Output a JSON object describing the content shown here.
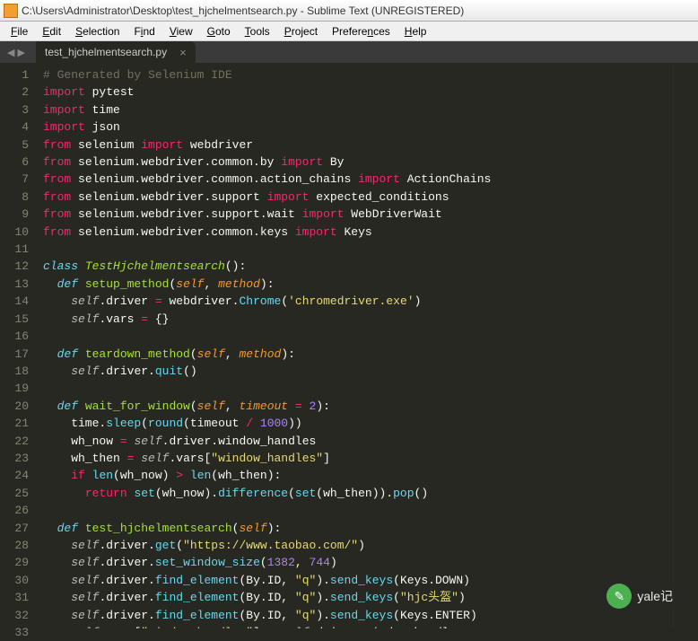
{
  "window": {
    "title": "C:\\Users\\Administrator\\Desktop\\test_hjchelmentsearch.py - Sublime Text (UNREGISTERED)"
  },
  "menu": {
    "items": [
      {
        "label": "File",
        "accel": "F"
      },
      {
        "label": "Edit",
        "accel": "E"
      },
      {
        "label": "Selection",
        "accel": "S"
      },
      {
        "label": "Find",
        "accel": "i"
      },
      {
        "label": "View",
        "accel": "V"
      },
      {
        "label": "Goto",
        "accel": "G"
      },
      {
        "label": "Tools",
        "accel": "T"
      },
      {
        "label": "Project",
        "accel": "P"
      },
      {
        "label": "Preferences",
        "accel": "n"
      },
      {
        "label": "Help",
        "accel": "H"
      }
    ]
  },
  "tab": {
    "name": "test_hjchelmentsearch.py",
    "close": "×"
  },
  "nav": {
    "arrows": "◀ ▶"
  },
  "code": {
    "lines": [
      [
        {
          "t": "# Generated by Selenium IDE",
          "c": "c-comment"
        }
      ],
      [
        {
          "t": "import",
          "c": "c-kw"
        },
        {
          "t": " pytest"
        }
      ],
      [
        {
          "t": "import",
          "c": "c-kw"
        },
        {
          "t": " time"
        }
      ],
      [
        {
          "t": "import",
          "c": "c-kw"
        },
        {
          "t": " json"
        }
      ],
      [
        {
          "t": "from",
          "c": "c-kw"
        },
        {
          "t": " selenium "
        },
        {
          "t": "import",
          "c": "c-kw"
        },
        {
          "t": " webdriver"
        }
      ],
      [
        {
          "t": "from",
          "c": "c-kw"
        },
        {
          "t": " selenium.webdriver.common.by "
        },
        {
          "t": "import",
          "c": "c-kw"
        },
        {
          "t": " By"
        }
      ],
      [
        {
          "t": "from",
          "c": "c-kw"
        },
        {
          "t": " selenium.webdriver.common.action_chains "
        },
        {
          "t": "import",
          "c": "c-kw"
        },
        {
          "t": " ActionChains"
        }
      ],
      [
        {
          "t": "from",
          "c": "c-kw"
        },
        {
          "t": " selenium.webdriver.support "
        },
        {
          "t": "import",
          "c": "c-kw"
        },
        {
          "t": " expected_conditions"
        }
      ],
      [
        {
          "t": "from",
          "c": "c-kw"
        },
        {
          "t": " selenium.webdriver.support.wait "
        },
        {
          "t": "import",
          "c": "c-kw"
        },
        {
          "t": " WebDriverWait"
        }
      ],
      [
        {
          "t": "from",
          "c": "c-kw"
        },
        {
          "t": " selenium.webdriver.common.keys "
        },
        {
          "t": "import",
          "c": "c-kw"
        },
        {
          "t": " Keys"
        }
      ],
      [],
      [
        {
          "t": "class",
          "c": "c-def"
        },
        {
          "t": " "
        },
        {
          "t": "TestHjchelmentsearch",
          "c": "c-cls"
        },
        {
          "t": "():"
        }
      ],
      [
        {
          "t": "  "
        },
        {
          "t": "def",
          "c": "c-def"
        },
        {
          "t": " "
        },
        {
          "t": "setup_method",
          "c": "c-fn"
        },
        {
          "t": "("
        },
        {
          "t": "self",
          "c": "c-param"
        },
        {
          "t": ", "
        },
        {
          "t": "method",
          "c": "c-param"
        },
        {
          "t": "):"
        }
      ],
      [
        {
          "t": "    "
        },
        {
          "t": "self",
          "c": "c-self"
        },
        {
          "t": ".driver "
        },
        {
          "t": "=",
          "c": "c-op"
        },
        {
          "t": " webdriver."
        },
        {
          "t": "Chrome",
          "c": "c-call"
        },
        {
          "t": "("
        },
        {
          "t": "'chromedriver.exe'",
          "c": "c-str"
        },
        {
          "t": ")"
        }
      ],
      [
        {
          "t": "    "
        },
        {
          "t": "self",
          "c": "c-self"
        },
        {
          "t": ".vars "
        },
        {
          "t": "=",
          "c": "c-op"
        },
        {
          "t": " {}"
        }
      ],
      [],
      [
        {
          "t": "  "
        },
        {
          "t": "def",
          "c": "c-def"
        },
        {
          "t": " "
        },
        {
          "t": "teardown_method",
          "c": "c-fn"
        },
        {
          "t": "("
        },
        {
          "t": "self",
          "c": "c-param"
        },
        {
          "t": ", "
        },
        {
          "t": "method",
          "c": "c-param"
        },
        {
          "t": "):"
        }
      ],
      [
        {
          "t": "    "
        },
        {
          "t": "self",
          "c": "c-self"
        },
        {
          "t": ".driver."
        },
        {
          "t": "quit",
          "c": "c-call"
        },
        {
          "t": "()"
        }
      ],
      [],
      [
        {
          "t": "  "
        },
        {
          "t": "def",
          "c": "c-def"
        },
        {
          "t": " "
        },
        {
          "t": "wait_for_window",
          "c": "c-fn"
        },
        {
          "t": "("
        },
        {
          "t": "self",
          "c": "c-param"
        },
        {
          "t": ", "
        },
        {
          "t": "timeout",
          "c": "c-param"
        },
        {
          "t": " "
        },
        {
          "t": "=",
          "c": "c-op"
        },
        {
          "t": " "
        },
        {
          "t": "2",
          "c": "c-num"
        },
        {
          "t": "):"
        }
      ],
      [
        {
          "t": "    time."
        },
        {
          "t": "sleep",
          "c": "c-call"
        },
        {
          "t": "("
        },
        {
          "t": "round",
          "c": "c-call"
        },
        {
          "t": "(timeout "
        },
        {
          "t": "/",
          "c": "c-op"
        },
        {
          "t": " "
        },
        {
          "t": "1000",
          "c": "c-num"
        },
        {
          "t": "))"
        }
      ],
      [
        {
          "t": "    wh_now "
        },
        {
          "t": "=",
          "c": "c-op"
        },
        {
          "t": " "
        },
        {
          "t": "self",
          "c": "c-self"
        },
        {
          "t": ".driver.window_handles"
        }
      ],
      [
        {
          "t": "    wh_then "
        },
        {
          "t": "=",
          "c": "c-op"
        },
        {
          "t": " "
        },
        {
          "t": "self",
          "c": "c-self"
        },
        {
          "t": ".vars["
        },
        {
          "t": "\"window_handles\"",
          "c": "c-str"
        },
        {
          "t": "]"
        }
      ],
      [
        {
          "t": "    "
        },
        {
          "t": "if",
          "c": "c-kw"
        },
        {
          "t": " "
        },
        {
          "t": "len",
          "c": "c-call"
        },
        {
          "t": "(wh_now) "
        },
        {
          "t": ">",
          "c": "c-op"
        },
        {
          "t": " "
        },
        {
          "t": "len",
          "c": "c-call"
        },
        {
          "t": "(wh_then):"
        }
      ],
      [
        {
          "t": "      "
        },
        {
          "t": "return",
          "c": "c-kw"
        },
        {
          "t": " "
        },
        {
          "t": "set",
          "c": "c-call"
        },
        {
          "t": "(wh_now)."
        },
        {
          "t": "difference",
          "c": "c-call"
        },
        {
          "t": "("
        },
        {
          "t": "set",
          "c": "c-call"
        },
        {
          "t": "(wh_then))."
        },
        {
          "t": "pop",
          "c": "c-call"
        },
        {
          "t": "()"
        }
      ],
      [],
      [
        {
          "t": "  "
        },
        {
          "t": "def",
          "c": "c-def"
        },
        {
          "t": " "
        },
        {
          "t": "test_hjchelmentsearch",
          "c": "c-fn"
        },
        {
          "t": "("
        },
        {
          "t": "self",
          "c": "c-param"
        },
        {
          "t": "):"
        }
      ],
      [
        {
          "t": "    "
        },
        {
          "t": "self",
          "c": "c-self"
        },
        {
          "t": ".driver."
        },
        {
          "t": "get",
          "c": "c-call"
        },
        {
          "t": "("
        },
        {
          "t": "\"https://www.taobao.com/\"",
          "c": "c-str"
        },
        {
          "t": ")"
        }
      ],
      [
        {
          "t": "    "
        },
        {
          "t": "self",
          "c": "c-self"
        },
        {
          "t": ".driver."
        },
        {
          "t": "set_window_size",
          "c": "c-call"
        },
        {
          "t": "("
        },
        {
          "t": "1382",
          "c": "c-num"
        },
        {
          "t": ", "
        },
        {
          "t": "744",
          "c": "c-num"
        },
        {
          "t": ")"
        }
      ],
      [
        {
          "t": "    "
        },
        {
          "t": "self",
          "c": "c-self"
        },
        {
          "t": ".driver."
        },
        {
          "t": "find_element",
          "c": "c-call"
        },
        {
          "t": "(By.ID, "
        },
        {
          "t": "\"q\"",
          "c": "c-str"
        },
        {
          "t": ")."
        },
        {
          "t": "send_keys",
          "c": "c-call"
        },
        {
          "t": "(Keys.DOWN)"
        }
      ],
      [
        {
          "t": "    "
        },
        {
          "t": "self",
          "c": "c-self"
        },
        {
          "t": ".driver."
        },
        {
          "t": "find_element",
          "c": "c-call"
        },
        {
          "t": "(By.ID, "
        },
        {
          "t": "\"q\"",
          "c": "c-str"
        },
        {
          "t": ")."
        },
        {
          "t": "send_keys",
          "c": "c-call"
        },
        {
          "t": "("
        },
        {
          "t": "\"hjc头盔\"",
          "c": "c-str"
        },
        {
          "t": ")"
        }
      ],
      [
        {
          "t": "    "
        },
        {
          "t": "self",
          "c": "c-self"
        },
        {
          "t": ".driver."
        },
        {
          "t": "find_element",
          "c": "c-call"
        },
        {
          "t": "(By.ID, "
        },
        {
          "t": "\"q\"",
          "c": "c-str"
        },
        {
          "t": ")."
        },
        {
          "t": "send_keys",
          "c": "c-call"
        },
        {
          "t": "(Keys.ENTER)"
        }
      ],
      [
        {
          "t": "    "
        },
        {
          "t": "self",
          "c": "c-self"
        },
        {
          "t": ".vars["
        },
        {
          "t": "\"window_handles\"",
          "c": "c-str"
        },
        {
          "t": "] "
        },
        {
          "t": "=",
          "c": "c-op"
        },
        {
          "t": " "
        },
        {
          "t": "self",
          "c": "c-self"
        },
        {
          "t": ".driver.window_handles"
        }
      ]
    ]
  },
  "watermark": {
    "text": "yale记",
    "icon": "✎"
  }
}
